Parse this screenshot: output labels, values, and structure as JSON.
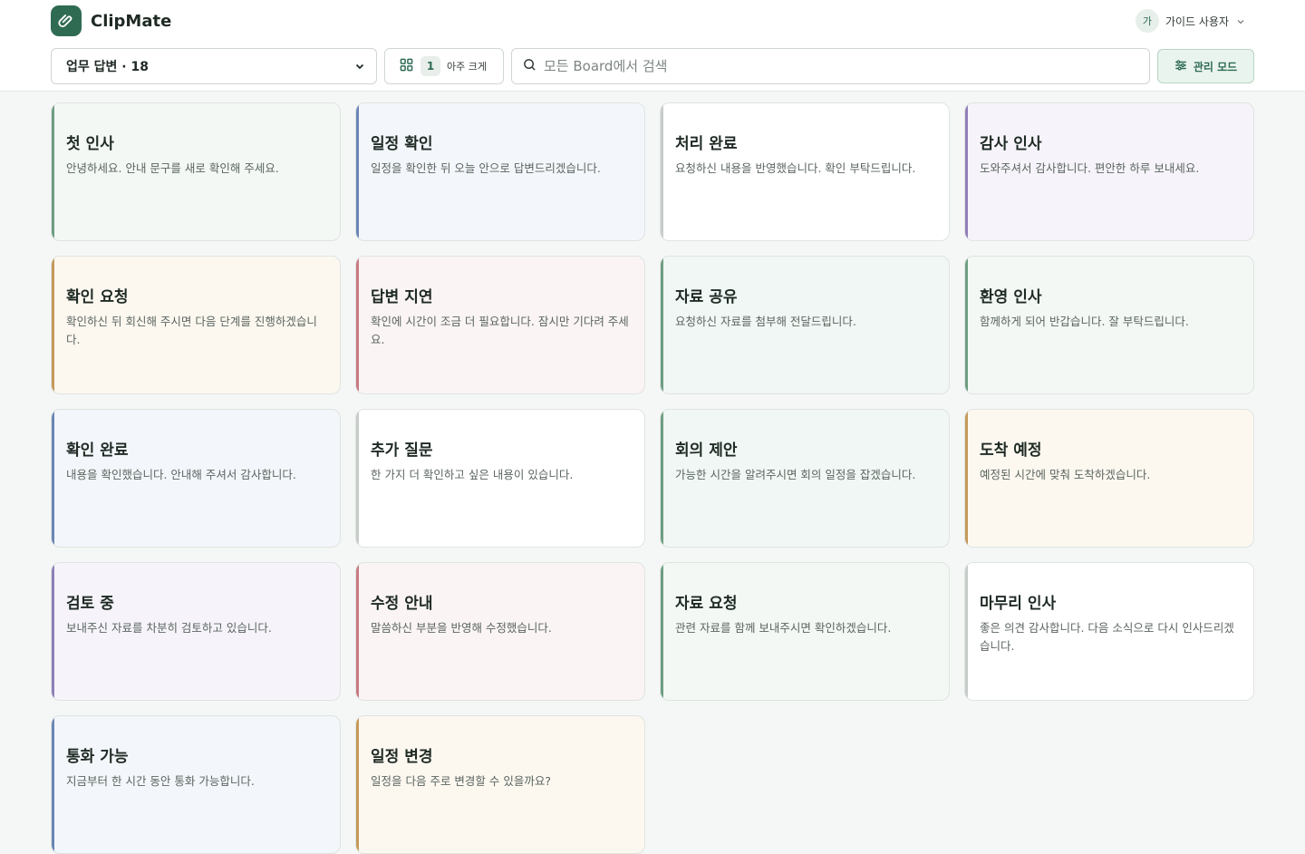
{
  "app": {
    "name": "ClipMate",
    "logo_icon": "paperclip-icon"
  },
  "user": {
    "avatar_initial": "가",
    "name": "가이드 사용자",
    "caret_icon": "chevron-down-icon"
  },
  "toolbar": {
    "board_select": "업무 답변 · 18",
    "size_icon": "grid-icon",
    "size_value": "1",
    "size_label": "아주 크게",
    "search_placeholder": "모든 Board에서 검색",
    "search_value": "",
    "manage_label": "관리 모드",
    "manage_icon": "sliders-icon"
  },
  "colors": {
    "brand": "#2f6b53",
    "green": "#6e9e82",
    "blue": "#6b86b4",
    "gray": "#c7ccc9",
    "purple": "#8f7fb8",
    "gold": "#c49a5a",
    "red": "#c77a82"
  },
  "cards": [
    {
      "title": "첫 인사",
      "body": "안녕하세요. 안내 문구를 새로 확인해 주세요.",
      "accent": "#6e9e82",
      "bg": "#f3f8f5"
    },
    {
      "title": "일정 확인",
      "body": "일정을 확인한 뒤 오늘 안으로 답변드리겠습니다.",
      "accent": "#6b86b4",
      "bg": "#f3f6fa"
    },
    {
      "title": "처리 완료",
      "body": "요청하신 내용을 반영했습니다. 확인 부탁드립니다.",
      "accent": "#c7ccc9",
      "bg": "#ffffff"
    },
    {
      "title": "감사 인사",
      "body": "도와주셔서 감사합니다. 편안한 하루 보내세요.",
      "accent": "#8f7fb8",
      "bg": "#f6f4fa"
    },
    {
      "title": "확인 요청",
      "body": "확인하신 뒤 회신해 주시면 다음 단계를 진행하겠습니다.",
      "accent": "#c49a5a",
      "bg": "#fcf8f0"
    },
    {
      "title": "답변 지연",
      "body": "확인에 시간이 조금 더 필요합니다. 잠시만 기다려 주세요.",
      "accent": "#c77a82",
      "bg": "#faf4f4"
    },
    {
      "title": "자료 공유",
      "body": "요청하신 자료를 첨부해 전달드립니다.",
      "accent": "#6e9e82",
      "bg": "#f1f7f4"
    },
    {
      "title": "환영 인사",
      "body": "함께하게 되어 반갑습니다. 잘 부탁드립니다.",
      "accent": "#6e9e82",
      "bg": "#f3f8f5"
    },
    {
      "title": "확인 완료",
      "body": "내용을 확인했습니다. 안내해 주셔서 감사합니다.",
      "accent": "#6b86b4",
      "bg": "#f3f6fa"
    },
    {
      "title": "추가 질문",
      "body": "한 가지 더 확인하고 싶은 내용이 있습니다.",
      "accent": "#c7ccc9",
      "bg": "#ffffff"
    },
    {
      "title": "회의 제안",
      "body": "가능한 시간을 알려주시면 회의 일정을 잡겠습니다.",
      "accent": "#6e9e82",
      "bg": "#f1f7f4"
    },
    {
      "title": "도착 예정",
      "body": "예정된 시간에 맞춰 도착하겠습니다.",
      "accent": "#c49a5a",
      "bg": "#fcf8f0"
    },
    {
      "title": "검토 중",
      "body": "보내주신 자료를 차분히 검토하고 있습니다.",
      "accent": "#8f7fb8",
      "bg": "#f6f4fa"
    },
    {
      "title": "수정 안내",
      "body": "말씀하신 부분을 반영해 수정했습니다.",
      "accent": "#c77a82",
      "bg": "#faf4f4"
    },
    {
      "title": "자료 요청",
      "body": "관련 자료를 함께 보내주시면 확인하겠습니다.",
      "accent": "#6e9e82",
      "bg": "#f3f8f5"
    },
    {
      "title": "마무리 인사",
      "body": "좋은 의견 감사합니다. 다음 소식으로 다시 인사드리겠습니다.",
      "accent": "#c7ccc9",
      "bg": "#ffffff"
    },
    {
      "title": "통화 가능",
      "body": "지금부터 한 시간 동안 통화 가능합니다.",
      "accent": "#6b86b4",
      "bg": "#f3f6fa"
    },
    {
      "title": "일정 변경",
      "body": "일정을 다음 주로 변경할 수 있을까요?",
      "accent": "#c49a5a",
      "bg": "#fcf8f0"
    }
  ]
}
